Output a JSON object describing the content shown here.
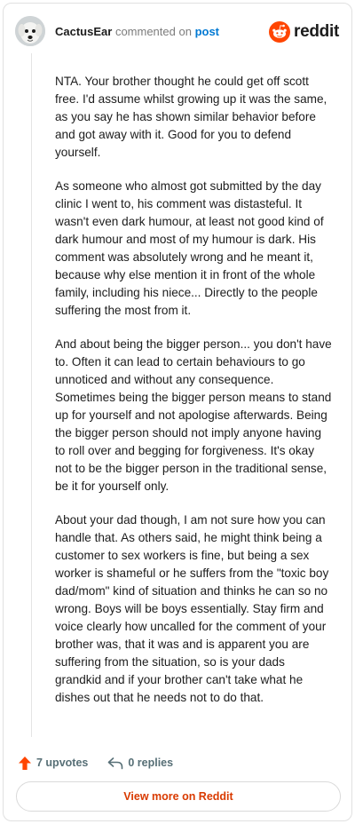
{
  "header": {
    "username": "CactusEar",
    "verb": "commented on",
    "post_link": "post",
    "brand": "reddit"
  },
  "comment": {
    "paragraphs": [
      "NTA. Your brother thought he could get off scott free. I'd assume whilst growing up it was the same, as you say he has shown similar behavior before and got away with it. Good for you to defend yourself.",
      "As someone who almost got submitted by the day clinic I went to, his comment was distasteful. It wasn't even dark humour, at least not good kind of dark humour and most of my humour is dark. His comment was absolutely wrong and he meant it, because why else mention it in front of the whole family, including his niece... Directly to the people suffering the most from it.",
      "And about being the bigger person... you don't have to. Often it can lead to certain behaviours to go unnoticed and without any consequence. Sometimes being the bigger person means to stand up for yourself and not apologise afterwards. Being the bigger person should not imply anyone having to roll over and begging for forgiveness. It's okay not to be the bigger person in the traditional sense, be it for yourself only.",
      "About your dad though, I am not sure how you can handle that. As others said, he might think being a customer to sex workers is fine, but being a sex worker is shameful or he suffers from the \"toxic boy dad/mom\" kind of situation and thinks he can so no wrong. Boys will be boys essentially. Stay firm and voice clearly how uncalled for the comment of your brother was, that it was and is apparent you are suffering from the situation, so is your dads grandkid and if your brother can't take what he dishes out that he needs not to do that."
    ]
  },
  "actions": {
    "upvotes": "7 upvotes",
    "replies": "0 replies"
  },
  "footer": {
    "view_more": "View more on Reddit"
  },
  "icons": {
    "avatar": "dog-avatar",
    "brand": "reddit-snoo-icon",
    "upvote": "upvote-arrow-icon",
    "reply": "reply-arrow-icon"
  },
  "colors": {
    "brand_orange": "#ff4500",
    "link_blue": "#0079d3",
    "action_gray": "#576f76",
    "view_more": "#d93a00"
  }
}
